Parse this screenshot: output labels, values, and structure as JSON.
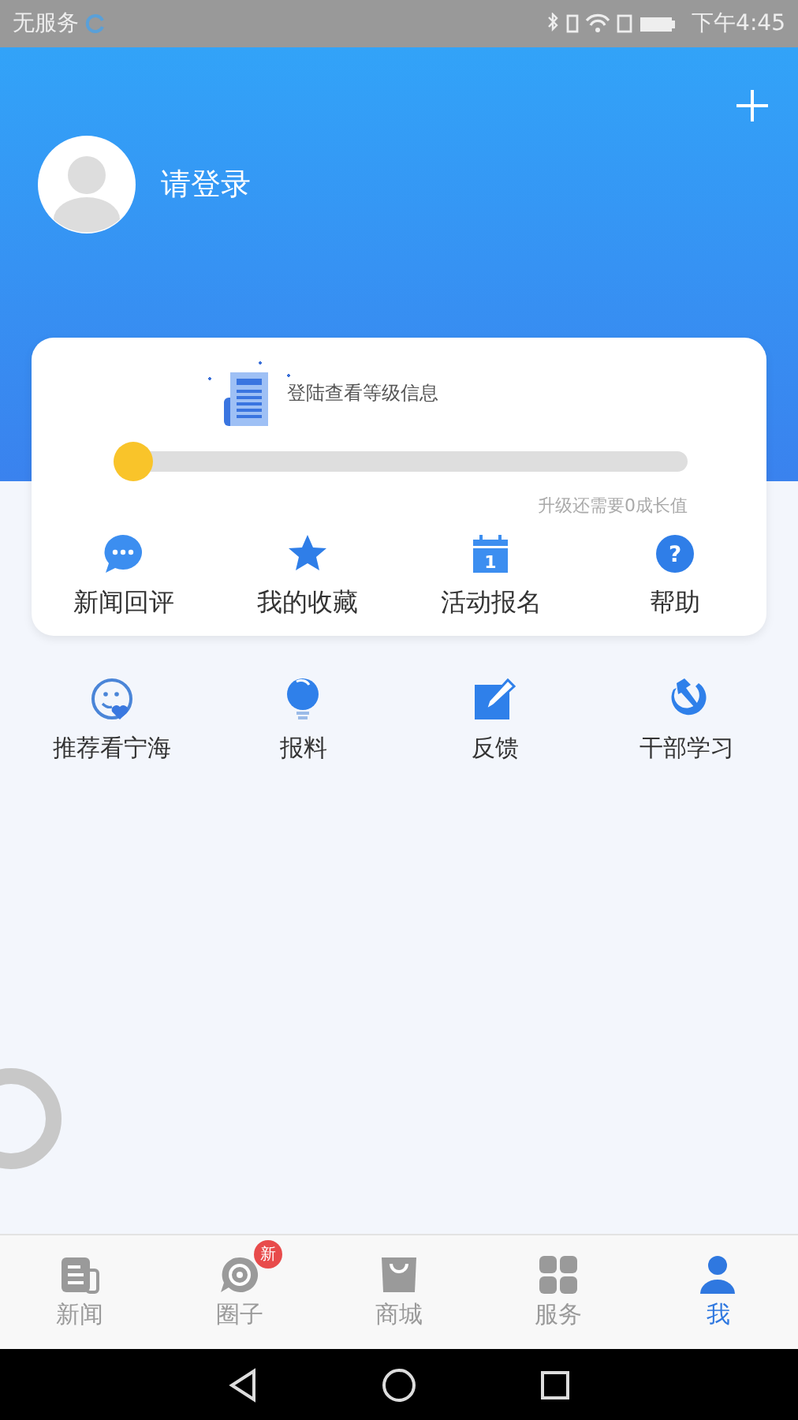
{
  "status_bar": {
    "carrier": "无服务",
    "time": "下午4:45"
  },
  "header": {
    "login": "请登录"
  },
  "level_card": {
    "hint": "登陆查看等级信息",
    "level": 0,
    "progress_note": "升级还需要0成长值",
    "shortcuts": [
      {
        "label": "新闻回评",
        "kind": "chat"
      },
      {
        "label": "我的收藏",
        "kind": "star"
      },
      {
        "label": "活动报名",
        "kind": "calendar",
        "icon_text": "1"
      },
      {
        "label": "帮助",
        "kind": "help",
        "icon_text": "?"
      }
    ]
  },
  "services": [
    {
      "label": "推荐看宁海",
      "kind": "smile"
    },
    {
      "label": "报料",
      "kind": "bulb"
    },
    {
      "label": "反馈",
      "kind": "edit"
    },
    {
      "label": "干部学习",
      "kind": "emblem"
    }
  ],
  "tabs": [
    {
      "label": "新闻",
      "kind": "news",
      "selected": false
    },
    {
      "label": "圈子",
      "kind": "circle",
      "selected": false,
      "badge": "新"
    },
    {
      "label": "商城",
      "kind": "shop",
      "selected": false
    },
    {
      "label": "服务",
      "kind": "grid",
      "selected": false
    },
    {
      "label": "我",
      "kind": "person",
      "selected": true
    }
  ]
}
